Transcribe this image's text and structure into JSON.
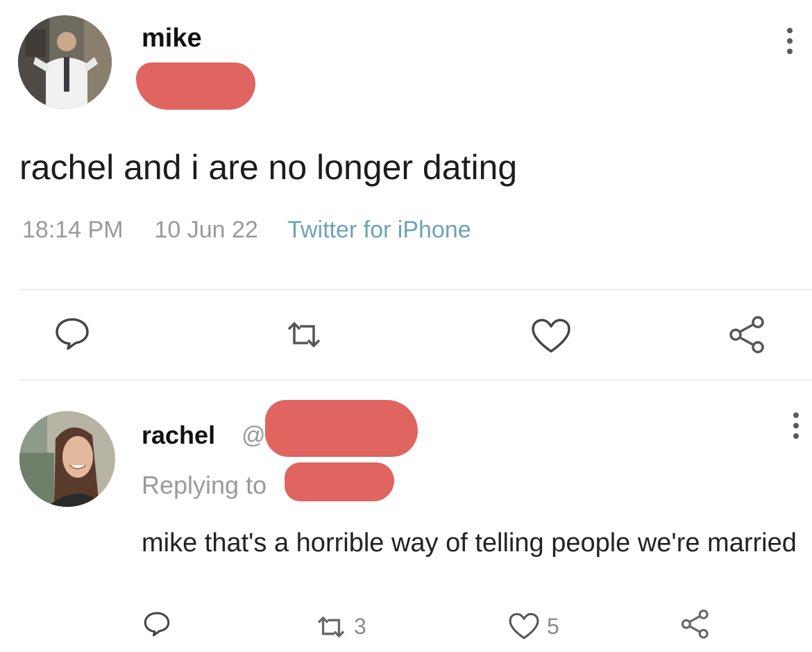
{
  "tweet": {
    "author_name": "mike",
    "text": "rachel and i are no longer dating",
    "time": "18:14 PM",
    "date": "10 Jun 22",
    "source": "Twitter for iPhone",
    "more_icon": "more-vertical-icon"
  },
  "actions": {
    "reply_icon": "comment-icon",
    "retweet_icon": "retweet-icon",
    "like_icon": "heart-icon",
    "share_icon": "share-icon"
  },
  "reply": {
    "author_name": "rachel",
    "handle_prefix": "@",
    "replying_to": "Replying to",
    "text": "mike that's a horrible way of telling people we're married",
    "retweet_count": "3",
    "like_count": "5"
  },
  "colors": {
    "redaction": "#e0645f",
    "source_link": "#6ba3b5",
    "meta_gray": "#9a9a9a"
  }
}
